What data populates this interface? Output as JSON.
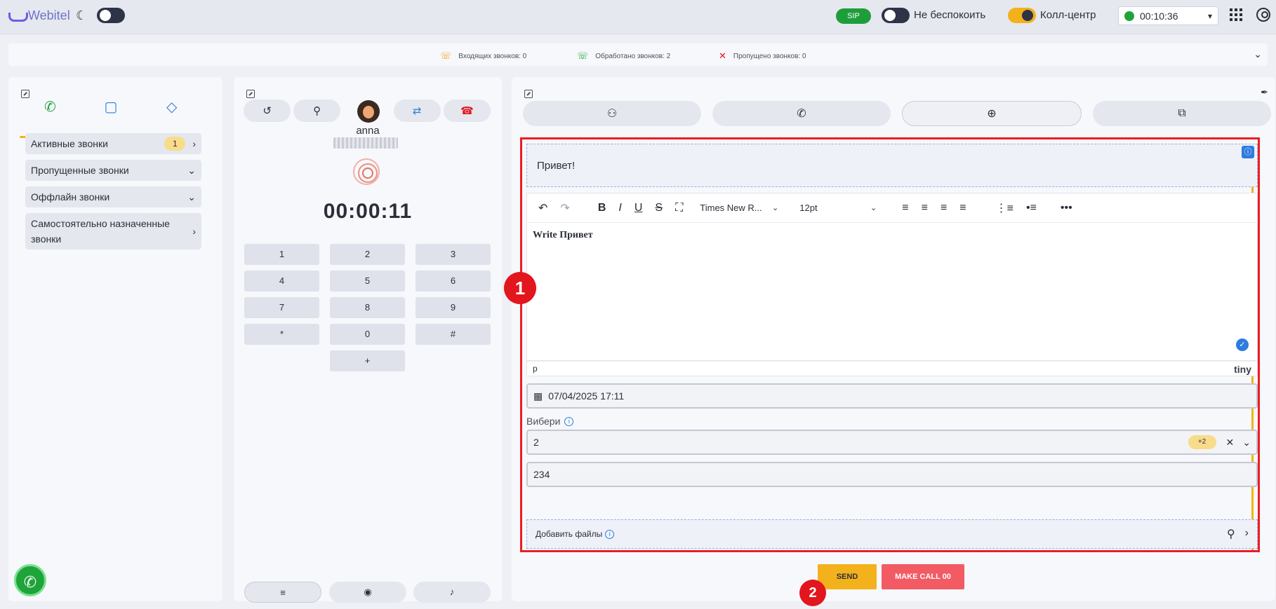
{
  "header": {
    "logo": "Webitel",
    "sip": "SIP",
    "dnd_label": "Не беспокоить",
    "callcenter_label": "Колл-центр",
    "timer": "00:10:36"
  },
  "stats": {
    "incoming": "Входящих звонков: 0",
    "processed": "Обработано звонков: 2",
    "missed": "Пропущено звонков: 0"
  },
  "left": {
    "items": [
      {
        "label": "Активные звонки",
        "badge": "1"
      },
      {
        "label": "Пропущенные звонки"
      },
      {
        "label": "Оффлайн звонки"
      },
      {
        "label": "Самостоятельно назначенные звонки"
      }
    ]
  },
  "middle": {
    "contact_name": "anna",
    "call_timer": "00:00:11",
    "keys": [
      "1",
      "2",
      "3",
      "4",
      "5",
      "6",
      "7",
      "8",
      "9",
      "*",
      "0",
      "#",
      "+"
    ]
  },
  "right": {
    "greeting": "Привет!",
    "editor_content": "Write Привет",
    "font_family": "Times New R...",
    "font_size": "12pt",
    "status_path": "p",
    "tiny_label": "tiny",
    "date_value": "07/04/2025 17:11",
    "select_label": "Вибери",
    "select_value": "2",
    "select_more": "+2",
    "text_value": "234",
    "files_label": "Добавить файлы"
  },
  "buttons": {
    "send": "SEND",
    "make_call": "MAKE CALL 00"
  },
  "markers": {
    "one": "1",
    "two": "2"
  },
  "colors": {
    "accent": "#f3b21b",
    "green": "#1ea43a",
    "highlight": "#ec1c24",
    "blue": "#2f7be0"
  }
}
